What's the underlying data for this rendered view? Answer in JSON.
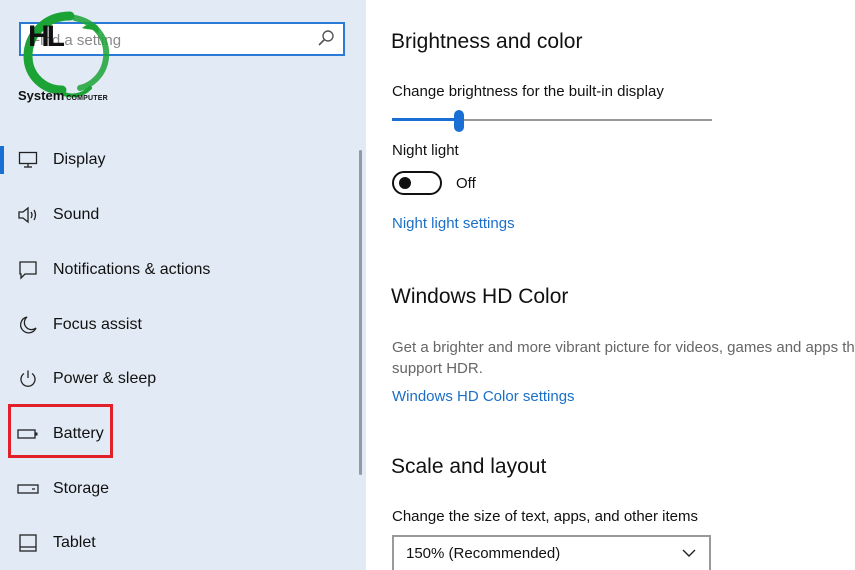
{
  "search": {
    "placeholder": "Find a setting"
  },
  "logo": {
    "letters": "HL",
    "name": "System",
    "tag": "COMPUTER"
  },
  "sidebar": {
    "items": [
      {
        "label": "Display",
        "icon": "monitor-icon",
        "selected": true
      },
      {
        "label": "Sound",
        "icon": "speaker-icon"
      },
      {
        "label": "Notifications & actions",
        "icon": "notification-icon"
      },
      {
        "label": "Focus assist",
        "icon": "moon-icon"
      },
      {
        "label": "Power & sleep",
        "icon": "power-icon"
      },
      {
        "label": "Battery",
        "icon": "battery-icon",
        "highlighted": true
      },
      {
        "label": "Storage",
        "icon": "storage-icon"
      },
      {
        "label": "Tablet",
        "icon": "tablet-icon"
      }
    ]
  },
  "colors": {
    "accent": "#1a6fd4",
    "link": "#1a6fc9",
    "highlight": "#e2202a",
    "sidebar_bg": "#e2ebf5"
  },
  "main": {
    "brightness": {
      "title": "Brightness and color",
      "slider_label": "Change brightness for the built-in display",
      "slider_value": 0.21
    },
    "night_light": {
      "label": "Night light",
      "state": "Off",
      "settings_link": "Night light settings"
    },
    "hd_color": {
      "title": "Windows HD Color",
      "desc_line1": "Get a brighter and more vibrant picture for videos, games and apps that",
      "desc_line2": "support HDR.",
      "settings_link": "Windows HD Color settings"
    },
    "scale": {
      "title": "Scale and layout",
      "label": "Change the size of text, apps, and other items",
      "value": "150% (Recommended)"
    }
  }
}
